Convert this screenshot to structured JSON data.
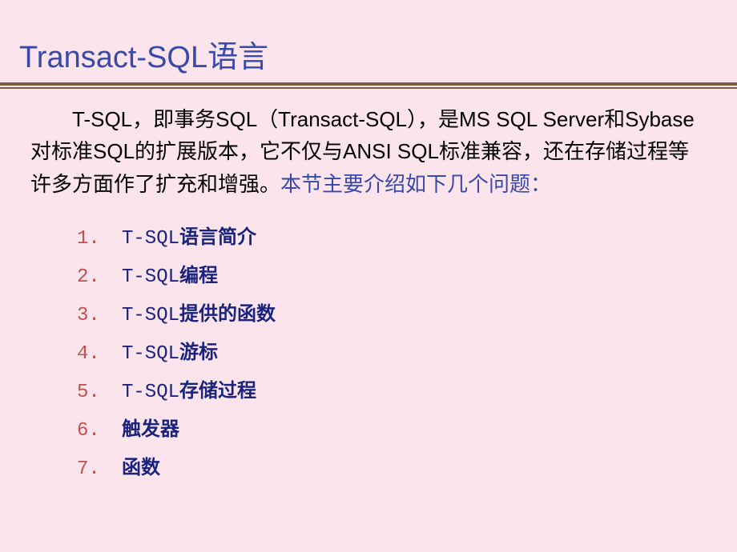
{
  "title": "Transact-SQL语言",
  "paragraph_main": "T-SQL，即事务SQL（Transact-SQL），是MS SQL Server和Sybase对标准SQL的扩展版本，它不仅与ANSI SQL标准兼容，还在存储过程等许多方面作了扩充和增强。",
  "paragraph_highlight": "本节主要介绍如下几个问题：",
  "list": [
    {
      "num": "1.",
      "latin": "T-SQL",
      "cjk": "语言简介"
    },
    {
      "num": "2.",
      "latin": "T-SQL",
      "cjk": "编程"
    },
    {
      "num": "3.",
      "latin": "T-SQL",
      "cjk": "提供的函数"
    },
    {
      "num": "4.",
      "latin": "T-SQL",
      "cjk": "游标"
    },
    {
      "num": "5.",
      "latin": "T-SQL",
      "cjk": "存储过程"
    },
    {
      "num": "6.",
      "latin": "",
      "cjk": "触发器"
    },
    {
      "num": "7.",
      "latin": "",
      "cjk": "函数"
    }
  ]
}
